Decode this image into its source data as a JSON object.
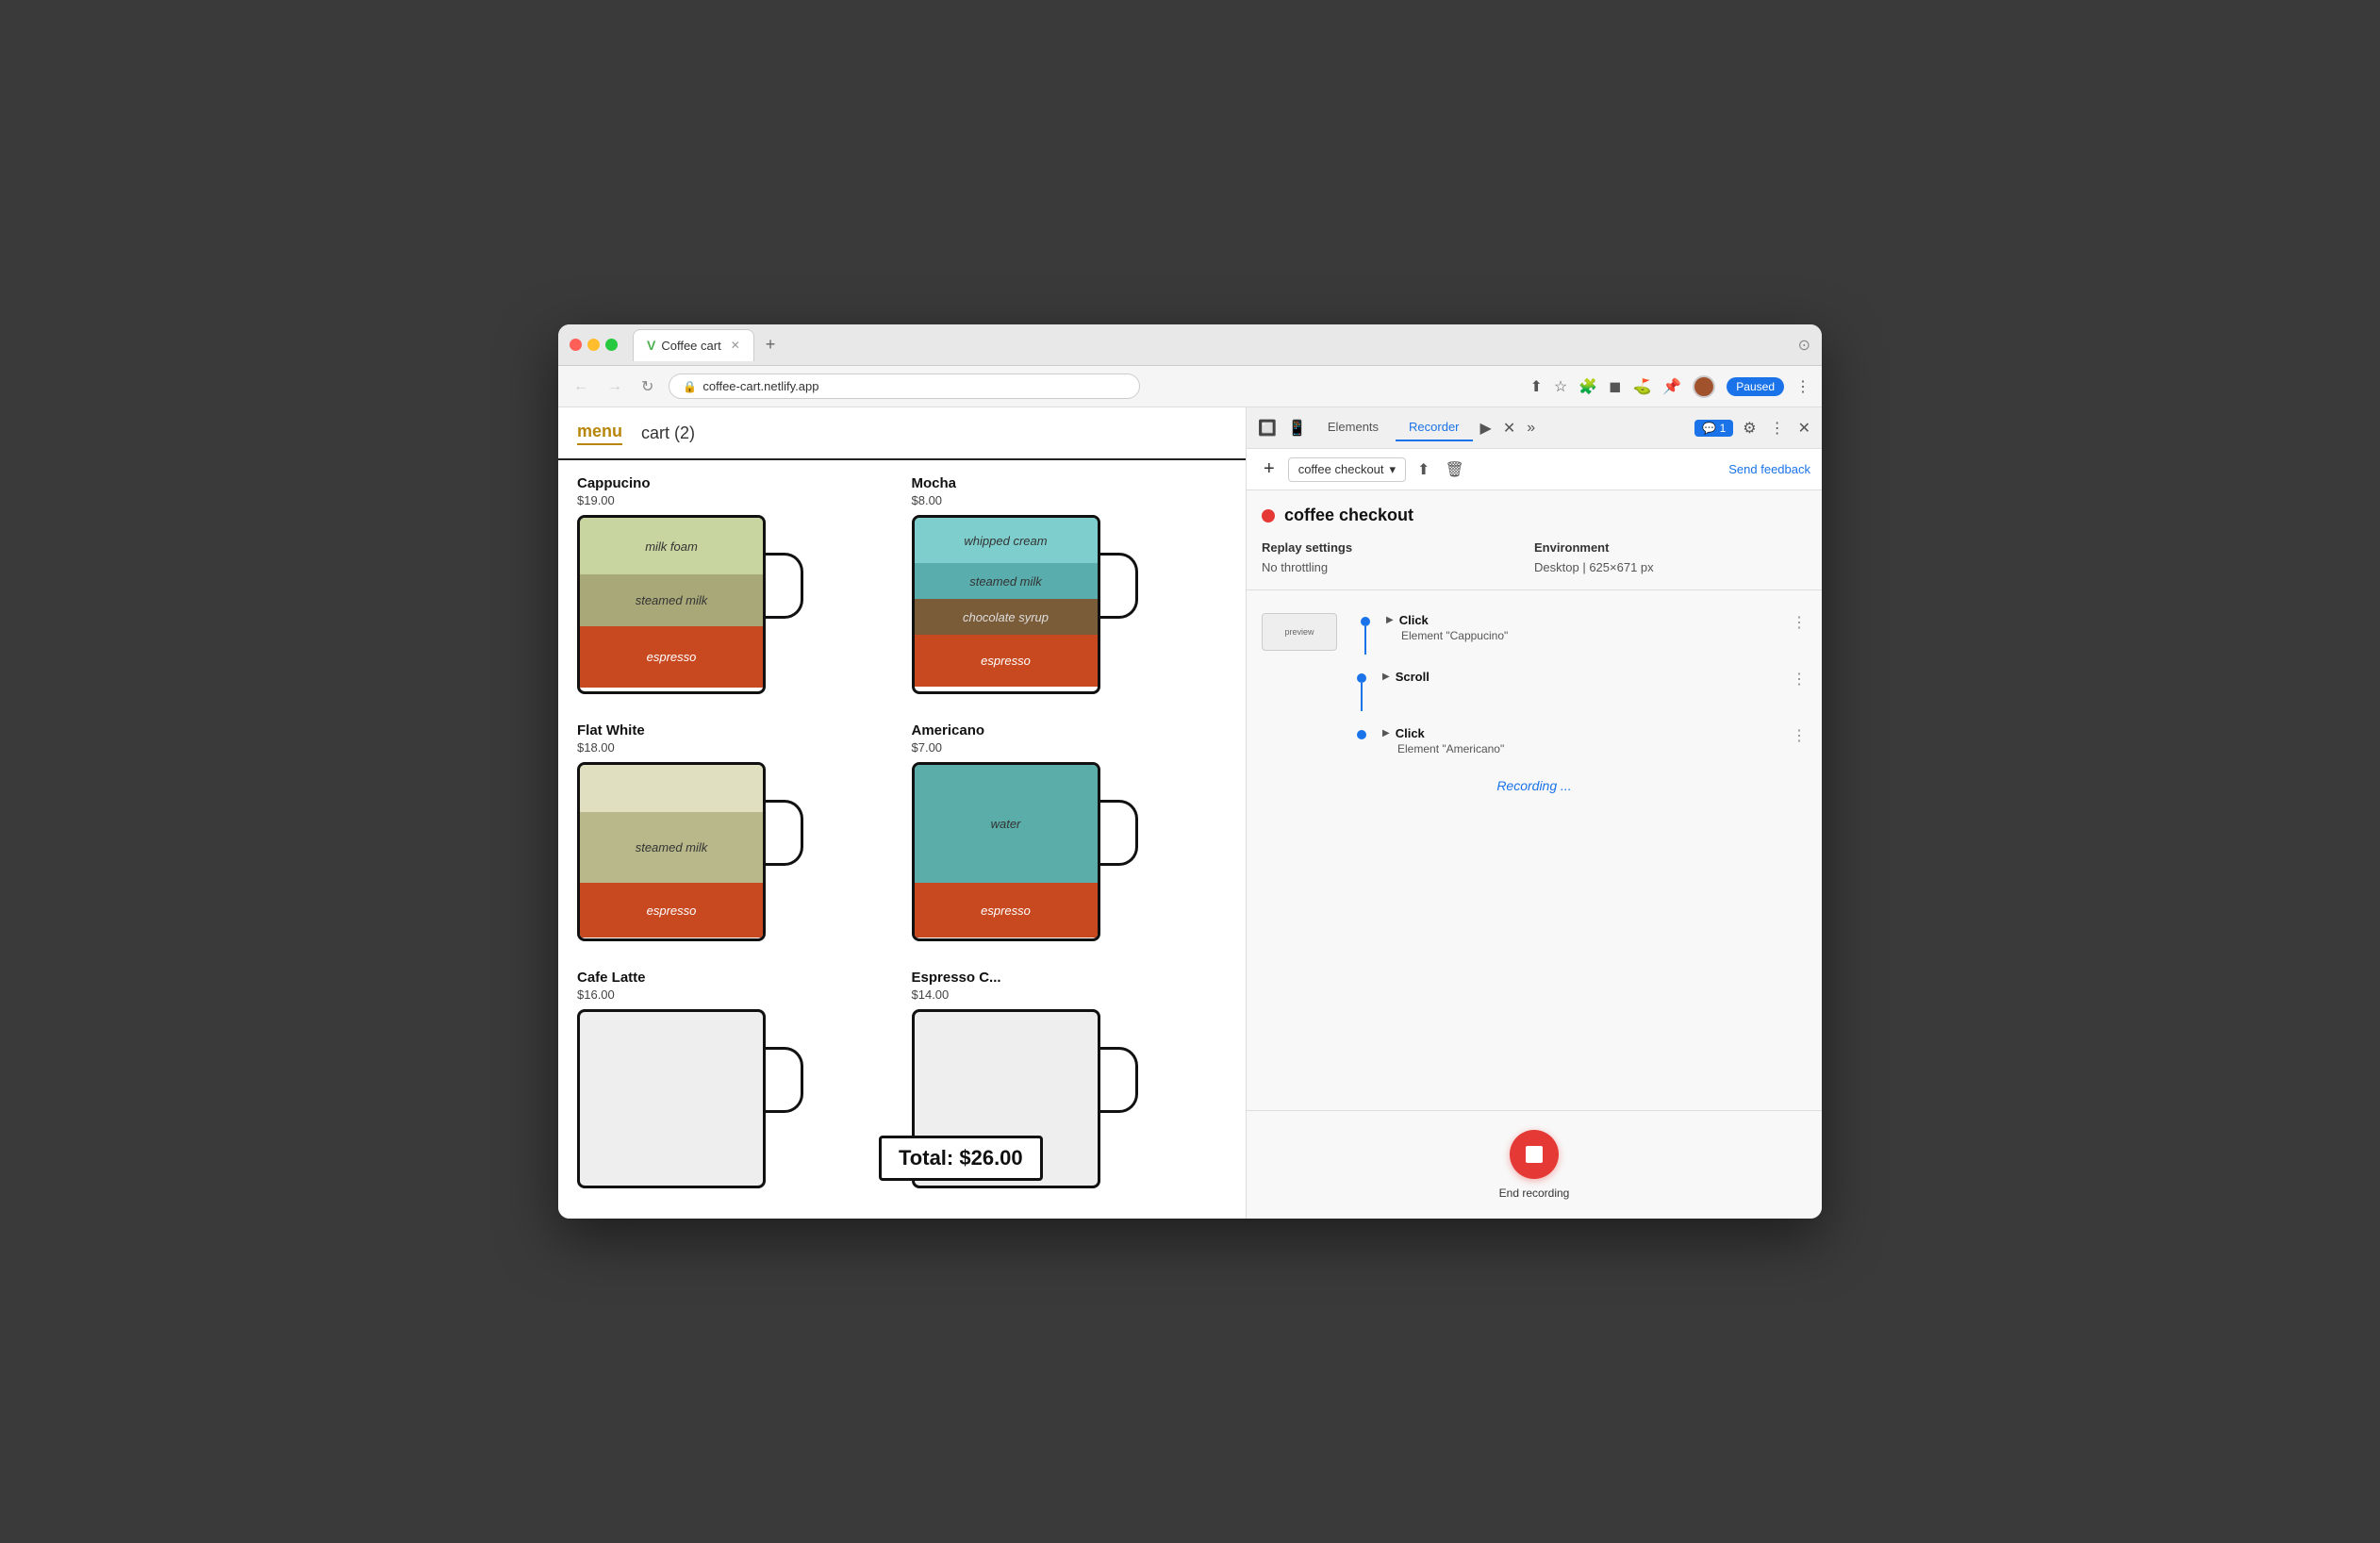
{
  "browser": {
    "tab_title": "Coffee cart",
    "tab_favicon": "V",
    "url": "coffee-cart.netlify.app",
    "new_tab_label": "+",
    "window_icon": "⊙"
  },
  "nav": {
    "menu_label": "menu",
    "cart_label": "cart (2)"
  },
  "coffees": [
    {
      "name": "Cappucino",
      "price": "$19.00",
      "layers": [
        {
          "label": "milk foam",
          "height": 60,
          "color": "#c8d5a0"
        },
        {
          "label": "steamed milk",
          "height": 55,
          "color": "#a8a878"
        },
        {
          "label": "espresso",
          "height": 65,
          "color": "#c84820"
        }
      ]
    },
    {
      "name": "Mocha",
      "price": "$8.00",
      "layers": [
        {
          "label": "whipped cream",
          "height": 50,
          "color": "#7ecece"
        },
        {
          "label": "steamed milk",
          "height": 40,
          "color": "#5aadad"
        },
        {
          "label": "chocolate syrup",
          "height": 40,
          "color": "#7a5c38"
        },
        {
          "label": "espresso",
          "height": 55,
          "color": "#c84820"
        }
      ]
    },
    {
      "name": "Flat White",
      "price": "$18.00",
      "layers": [
        {
          "label": "",
          "height": 55,
          "color": "#d8d8b8"
        },
        {
          "label": "steamed milk",
          "height": 70,
          "color": "#b8b88a"
        },
        {
          "label": "espresso",
          "height": 58,
          "color": "#c84820"
        }
      ]
    },
    {
      "name": "Americano",
      "price": "$7.00",
      "layers": [
        {
          "label": "water",
          "height": 120,
          "color": "#5aada8"
        },
        {
          "label": "espresso",
          "height": 60,
          "color": "#c84820"
        }
      ]
    },
    {
      "name": "Cafe Latte",
      "price": "$16.00",
      "layers": []
    },
    {
      "name": "Espresso C...",
      "price": "$14.00",
      "layers": []
    }
  ],
  "total": "Total: $26.00",
  "devtools": {
    "tabs": [
      "Elements",
      "Recorder",
      "▶ ✕",
      "»"
    ],
    "elements_label": "Elements",
    "recorder_label": "Recorder",
    "chat_badge": "1",
    "add_btn": "+",
    "recording_name": "coffee checkout",
    "send_feedback": "Send feedback",
    "record_dot_color": "#e53935",
    "recording_title": "coffee checkout",
    "replay_settings_label": "Replay settings",
    "throttling_label": "No throttling",
    "environment_label": "Environment",
    "environment_value": "Desktop",
    "resolution_value": "625×671 px",
    "steps": [
      {
        "type": "Click",
        "description": "Element \"Cappucino\""
      },
      {
        "type": "Scroll",
        "description": ""
      },
      {
        "type": "Click",
        "description": "Element \"Americano\""
      }
    ],
    "recording_status": "Recording ...",
    "end_recording_label": "End recording"
  }
}
